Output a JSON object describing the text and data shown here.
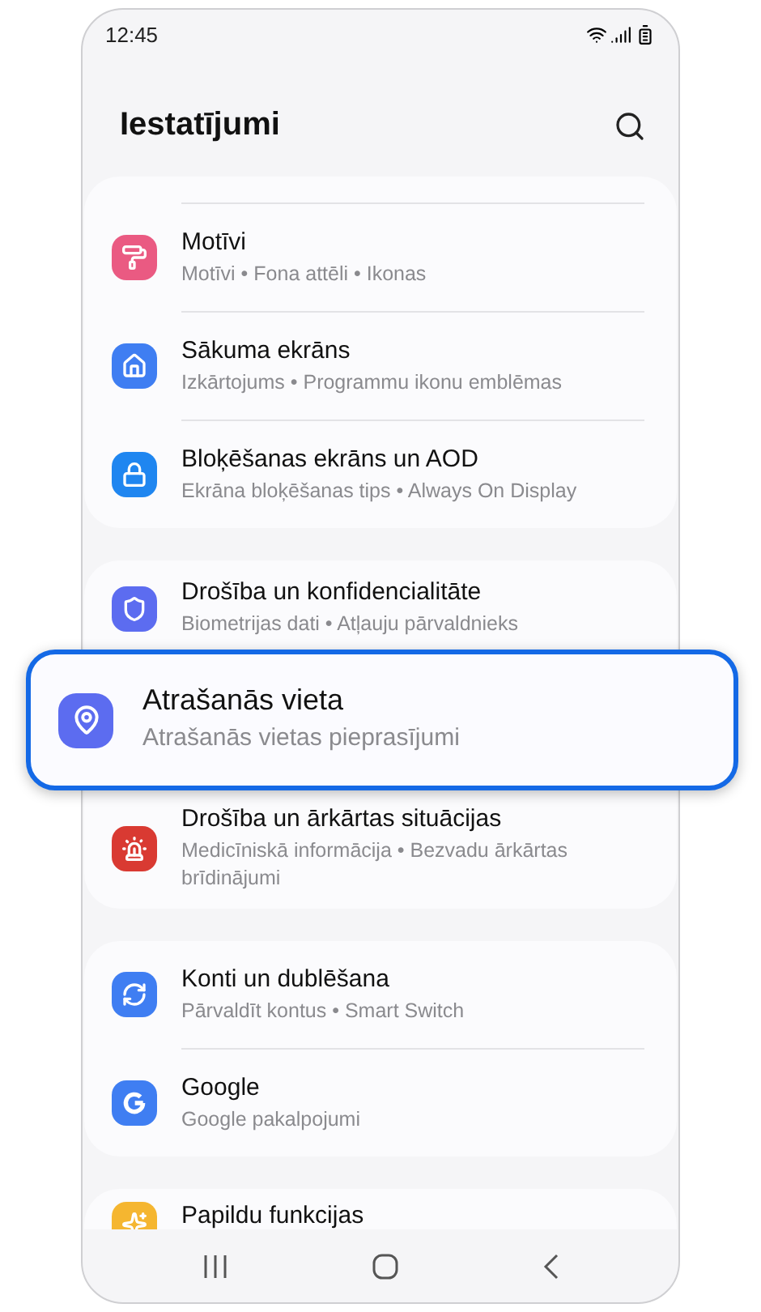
{
  "status_bar": {
    "time": "12:45"
  },
  "header": {
    "title": "Iestatījumi"
  },
  "groups": [
    {
      "items": [
        {
          "title": "Motīvi",
          "subtitle": "Motīvi • Fona attēli • Ikonas",
          "color": "#ea5a82",
          "highlighted": false
        },
        {
          "title": "Sākuma ekrāns",
          "subtitle": "Izkārtojums • Programmu ikonu emblēmas",
          "color": "#3f7ef2",
          "highlighted": false
        },
        {
          "title": "Bloķēšanas ekrāns un AOD",
          "subtitle": "Ekrāna bloķēšanas tips • Always On Display",
          "color": "#1f86f0",
          "highlighted": false
        }
      ]
    },
    {
      "items": [
        {
          "title": "Drošība un konfidencialitāte",
          "subtitle": "Biometrijas dati • Atļauju pārvaldnieks",
          "color": "#5c6cf0",
          "highlighted": false
        },
        {
          "title": "Atrašanās vieta",
          "subtitle": "Atrašanās vietas pieprasījumi",
          "color": "#5c6cf0",
          "highlighted": true
        },
        {
          "title": "Drošība un ārkārtas situācijas",
          "subtitle": "Medicīniskā informācija • Bezvadu ārkārtas brīdinājumi",
          "color": "#d93a32",
          "highlighted": false
        }
      ]
    },
    {
      "items": [
        {
          "title": "Konti un dublēšana",
          "subtitle": "Pārvaldīt kontus • Smart Switch",
          "color": "#3f7ef2",
          "highlighted": false
        },
        {
          "title": "Google",
          "subtitle": "Google pakalpojumi",
          "color": "#3f7ef2",
          "highlighted": false
        }
      ]
    },
    {
      "items": [
        {
          "title": "Papildu funkcijas",
          "color": "#f5b630",
          "highlighted": false
        }
      ]
    }
  ]
}
